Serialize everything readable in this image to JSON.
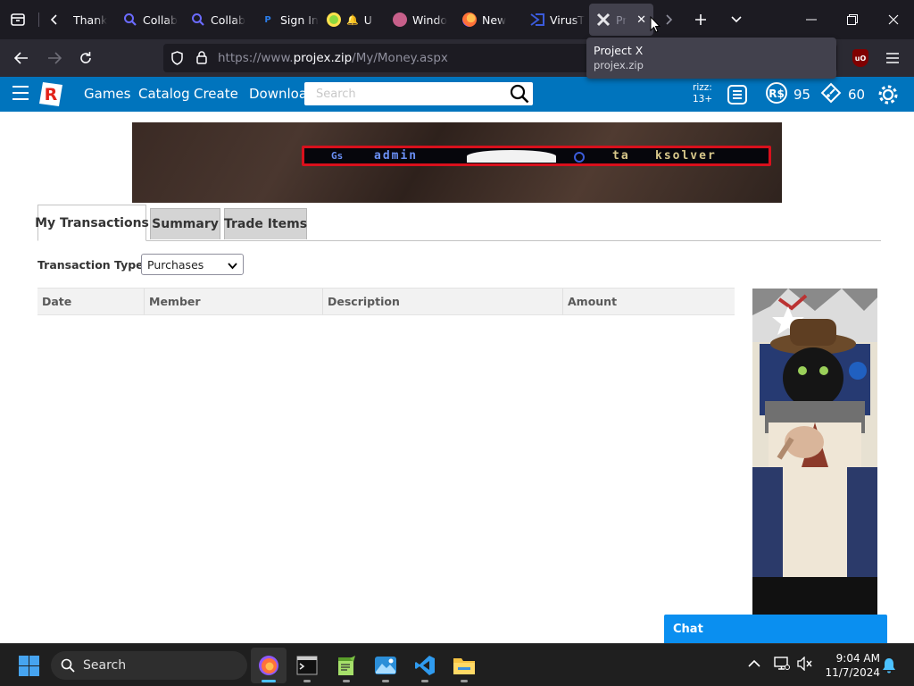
{
  "browser": {
    "tabs": [
      {
        "title": "Thank",
        "favicon": "",
        "favicon_color": "#1c1b22"
      },
      {
        "title": "Collab",
        "favicon": "Q",
        "favicon_color": "#5b5bff"
      },
      {
        "title": "Collab",
        "favicon": "Q",
        "favicon_color": "#5b5bff"
      },
      {
        "title": "Sign In",
        "favicon": "P",
        "favicon_color": "#1c1b22"
      },
      {
        "title": "U",
        "favicon": "",
        "favicon_color": "#8cd93f"
      },
      {
        "title": "Windo",
        "favicon": "",
        "favicon_color": "#c75f8a"
      },
      {
        "title": "New",
        "favicon": "",
        "favicon_color": "#ff7139"
      },
      {
        "title": "VirusT",
        "favicon": "",
        "favicon_color": "#3b5bdb"
      },
      {
        "title": "Pr",
        "favicon": "",
        "favicon_color": "#d7d7db"
      }
    ],
    "url_prefix": "https://www.",
    "url_host": "projex.zip",
    "url_path": "/My/Money.aspx",
    "tooltip": {
      "title": "Project X",
      "subtitle": "projex.zip"
    },
    "ublock_label": "uO"
  },
  "site": {
    "nav": [
      "Games",
      "Catalog",
      "Create",
      "Downloads"
    ],
    "search_placeholder": "Search",
    "age_label": "rizz:",
    "age_value": "13+",
    "robux": "95",
    "tickets": "60"
  },
  "banner": {
    "w1": "Gs",
    "w2": "admin",
    "w3": "ta",
    "w4": "ksolver"
  },
  "page": {
    "tabs": [
      "My Transactions",
      "Summary",
      "Trade Items"
    ],
    "filter_label": "Transaction Type:",
    "filter_value": "Purchases",
    "columns": [
      "Date",
      "Member",
      "Description",
      "Amount"
    ],
    "chat_label": "Chat"
  },
  "taskbar": {
    "search_label": "Search",
    "time": "9:04 AM",
    "date": "11/7/2024"
  }
}
